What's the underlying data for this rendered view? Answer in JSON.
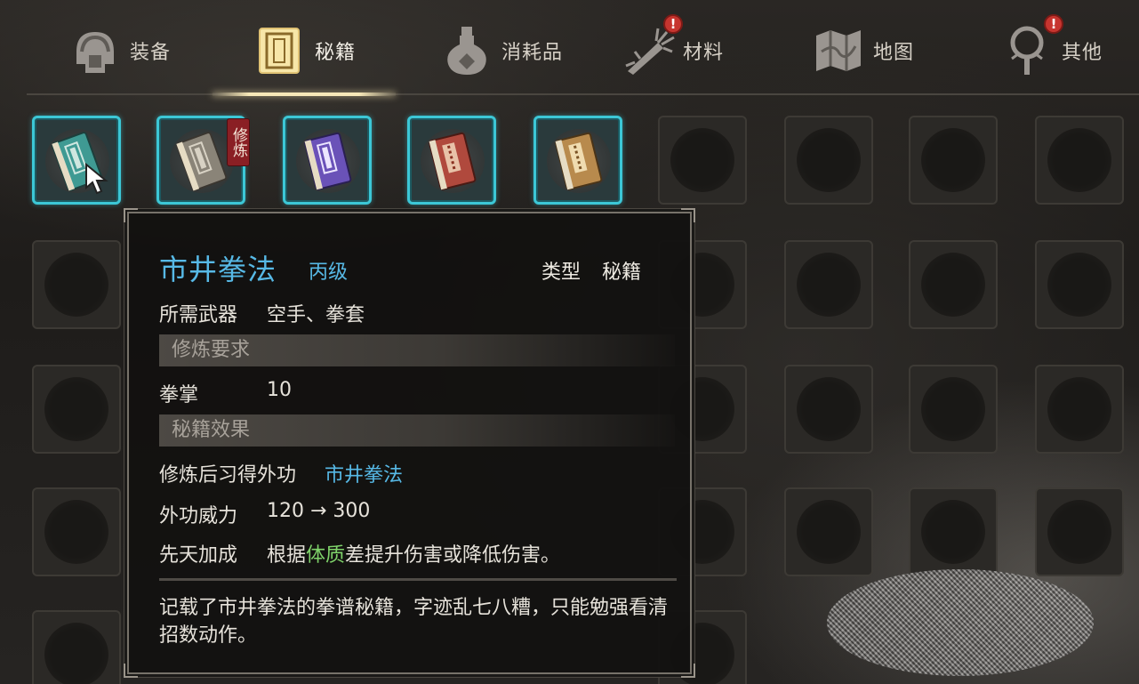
{
  "tabs": [
    {
      "id": "equipment",
      "label": "装备",
      "icon": "helmet-icon",
      "active": false,
      "badge": ""
    },
    {
      "id": "manuals",
      "label": "秘籍",
      "icon": "book-icon",
      "active": true,
      "badge": ""
    },
    {
      "id": "consumables",
      "label": "消耗品",
      "icon": "gourd-icon",
      "active": false,
      "badge": ""
    },
    {
      "id": "materials",
      "label": "材料",
      "icon": "ginseng-icon",
      "active": false,
      "badge": "!"
    },
    {
      "id": "map",
      "label": "地图",
      "icon": "map-icon",
      "active": false,
      "badge": ""
    },
    {
      "id": "other",
      "label": "其他",
      "icon": "mirror-icon",
      "active": false,
      "badge": "!"
    }
  ],
  "inventory": {
    "items": [
      {
        "name": "teal-manual",
        "color": "#3f9a93",
        "hovered": true,
        "tag": ""
      },
      {
        "name": "grey-manual",
        "color": "#8a8478",
        "hovered": false,
        "tag": "修炼"
      },
      {
        "name": "purple-manual",
        "color": "#6a52b8",
        "hovered": false,
        "tag": ""
      },
      {
        "name": "red-manual",
        "color": "#b0493d",
        "hovered": false,
        "tag": ""
      },
      {
        "name": "tan-manual",
        "color": "#b88a4d",
        "hovered": false,
        "tag": ""
      }
    ]
  },
  "tooltip": {
    "name": "市井拳法",
    "grade": "丙级",
    "type_label": "类型",
    "type_value": "秘籍",
    "weapon_label": "所需武器",
    "weapon_value": "空手、拳套",
    "req_section": "修炼要求",
    "req_label": "拳掌",
    "req_value": "10",
    "effect_section": "秘籍效果",
    "learn_label": "修炼后习得外功",
    "learn_value": "市井拳法",
    "power_label": "外功威力",
    "power_value": "120 → 300",
    "bonus_label": "先天加成",
    "bonus_prefix": "根据",
    "bonus_highlight": "体质",
    "bonus_suffix": "差提升伤害或降低伤害。",
    "description": "记载了市井拳法的拳谱秘籍，字迹乱七八糟，只能勉强看清招数动作。"
  },
  "colors": {
    "accent_blue": "#57b9e6",
    "slot_border": "#3cc7d6",
    "highlight_green": "#7fd36a",
    "badge_red": "#c7352f"
  }
}
